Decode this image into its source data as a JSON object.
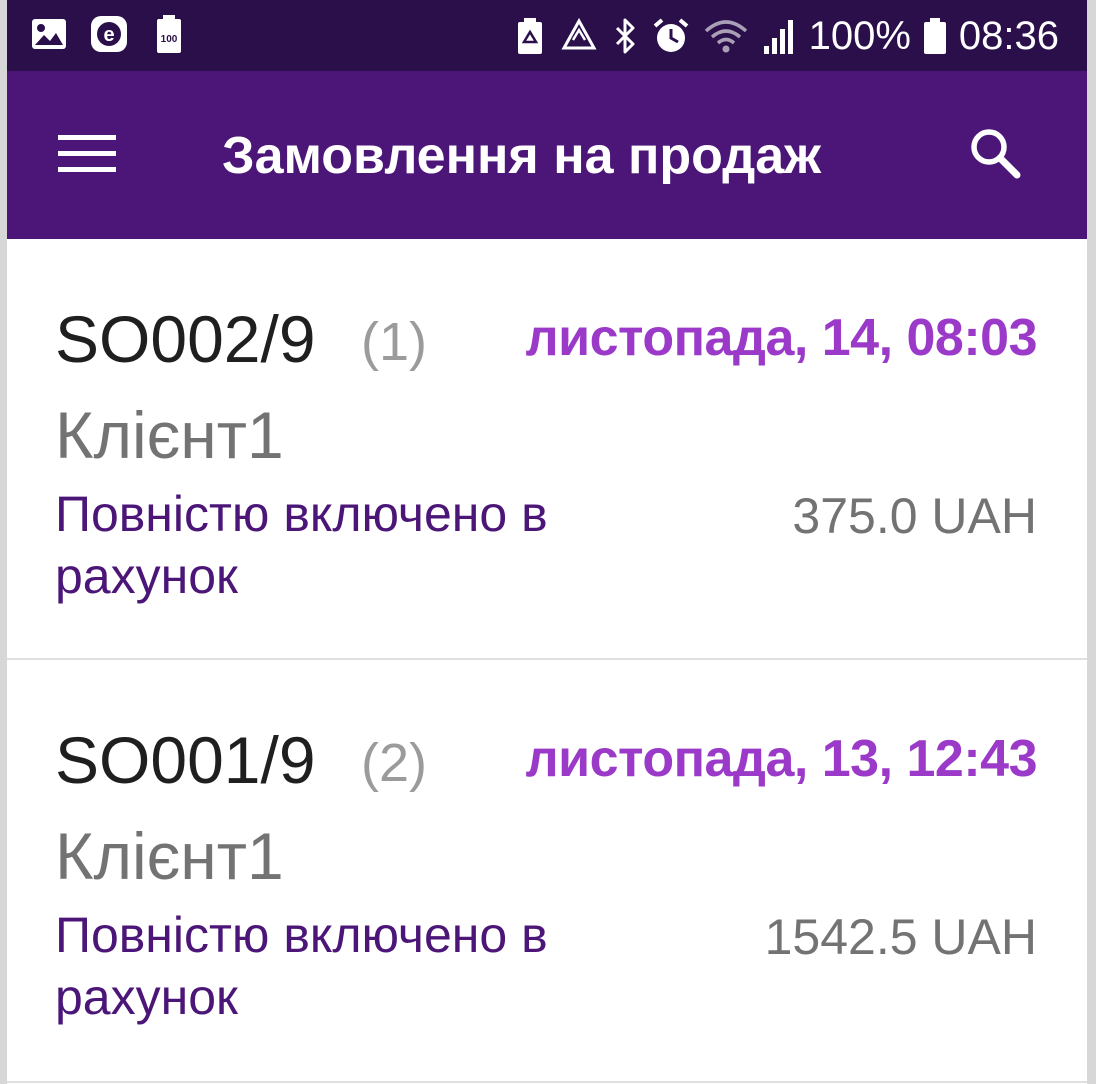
{
  "status_bar": {
    "left_icons": [
      "gallery-icon",
      "e-icon",
      "battery-saver-icon"
    ],
    "right_icons": [
      "battery-recycle-icon",
      "recycle-icon",
      "bluetooth-icon",
      "alarm-icon",
      "wifi-icon",
      "signal-icon"
    ],
    "battery": "100%",
    "time": "08:36"
  },
  "app_bar": {
    "title": "Замовлення на продаж",
    "menu_icon": "hamburger-menu-icon",
    "search_icon": "search-icon",
    "color": "#4b1677"
  },
  "colors": {
    "status_bar_bg": "#2a0f4a",
    "accent": "#9b39c9",
    "primary": "#4b1677"
  },
  "orders": [
    {
      "name": "SO002/9",
      "count": "(1)",
      "date": "листопада, 14, 08:03",
      "client": "Клієнт1",
      "status": "Повністю включено в рахунок",
      "amount": "375.0 UAH"
    },
    {
      "name": "SO001/9",
      "count": "(2)",
      "date": "листопада, 13, 12:43",
      "client": "Клієнт1",
      "status": "Повністю включено в рахунок",
      "amount": "1542.5 UAH"
    }
  ]
}
